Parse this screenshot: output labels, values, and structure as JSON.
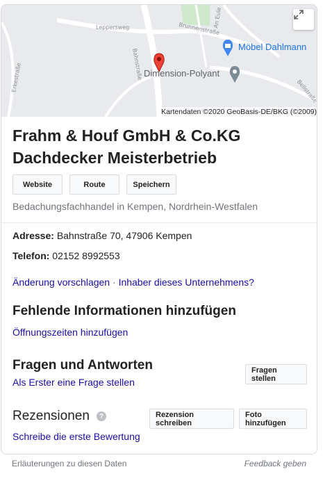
{
  "map": {
    "streets": [
      "Leppersweg",
      "Brunnenstraße",
      "Bahnstraße",
      "An Eule",
      "Erkestraße",
      "Bellstraße"
    ],
    "poi_primary": "Möbel Dahlmann",
    "poi_secondary": "Dimension-Polyant",
    "attribution": "Kartendaten ©2020 GeoBasis-DE/BKG (©2009)",
    "expand_icon": "expand-icon",
    "pin_color": "#ea4335"
  },
  "business": {
    "title": "Frahm & Houf GmbH & Co.KG Dachdecker Meisterbetrieb",
    "category": "Bedachungsfachhandel in Kempen, Nordrhein-Westfalen"
  },
  "actions": {
    "website": "Website",
    "route": "Route",
    "save": "Speichern"
  },
  "info": {
    "address_label": "Adresse:",
    "address_value": "Bahnstraße 70, 47906 Kempen",
    "phone_label": "Telefon:",
    "phone_value": "02152 8992553"
  },
  "links": {
    "suggest_edit": "Änderung vorschlagen",
    "separator": "·",
    "owner": "Inhaber dieses Unternehmens?"
  },
  "missing_info": {
    "title": "Fehlende Informationen hinzufügen",
    "add_hours": "Öffnungszeiten hinzufügen"
  },
  "qa": {
    "title": "Fragen und Antworten",
    "first_question": "Als Erster eine Frage stellen",
    "ask_button": "Fragen stellen"
  },
  "reviews": {
    "title": "Rezensionen",
    "help": "?",
    "write_review": "Rezension schreiben",
    "add_photo": "Foto hinzufügen",
    "first_review": "Schreibe die erste Bewertung"
  },
  "footer": {
    "explanations": "Erläuterungen zu diesen Daten",
    "feedback": "Feedback geben"
  },
  "colors": {
    "link": "#1a0dab",
    "poi_blue": "#1a73e8",
    "muted": "#70757a"
  }
}
